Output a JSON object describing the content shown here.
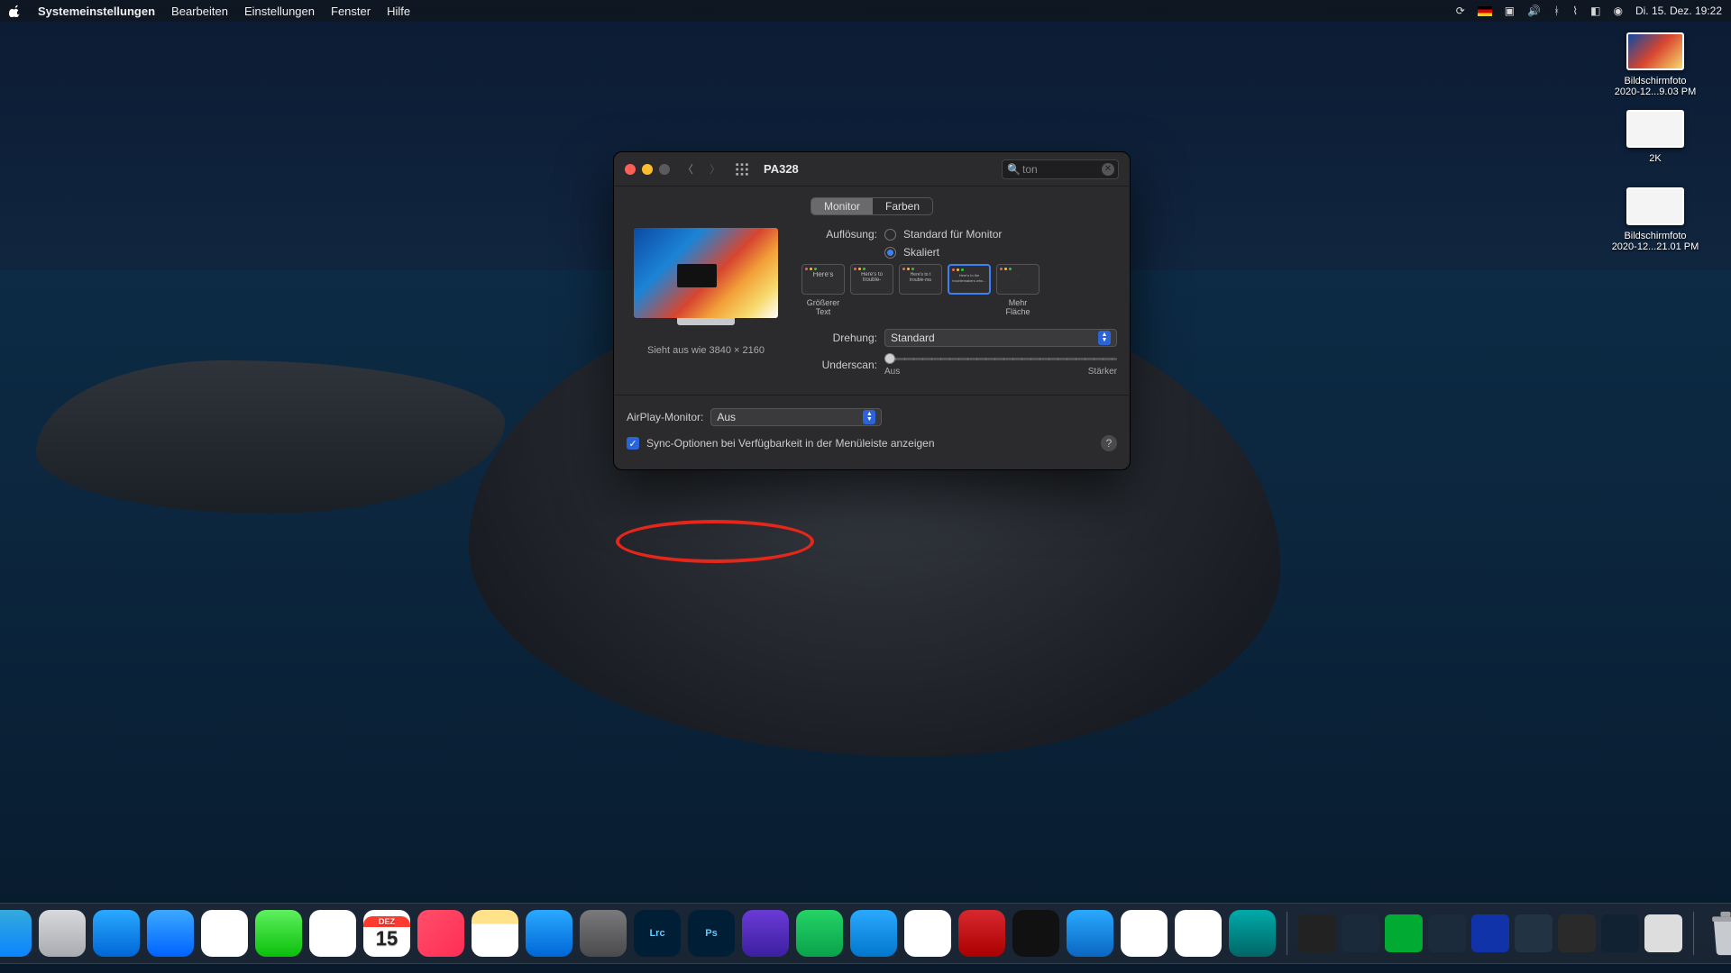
{
  "menubar": {
    "app": "Systemeinstellungen",
    "items": [
      "Bearbeiten",
      "Einstellungen",
      "Fenster",
      "Hilfe"
    ],
    "datetime": "Di. 15. Dez.  19:22"
  },
  "desktop": {
    "icons": [
      {
        "label_l1": "Bildschirmfoto",
        "label_l2": "2020-12...9.03 PM"
      },
      {
        "label_l1": "2K",
        "label_l2": ""
      },
      {
        "label_l1": "Bildschirmfoto",
        "label_l2": "2020-12...21.01 PM"
      }
    ]
  },
  "window": {
    "title": "PA328",
    "search_value": "ton",
    "tabs": {
      "monitor": "Monitor",
      "farben": "Farben"
    },
    "resolution_label": "Auflösung:",
    "res_std": "Standard für Monitor",
    "res_scaled": "Skaliert",
    "looks_like": "Sieht aus wie 3840 × 2160",
    "scale_opts": [
      {
        "preview": "Here's",
        "label": "Größerer Text"
      },
      {
        "preview": "Here's to trouble-",
        "label": ""
      },
      {
        "preview": "Here's to t trouble-ma",
        "label": ""
      },
      {
        "preview": "Here's to the troublemakers who...",
        "label": ""
      },
      {
        "preview": "",
        "label": "Mehr Fläche"
      }
    ],
    "rotation_label": "Drehung:",
    "rotation_value": "Standard",
    "underscan_label": "Underscan:",
    "underscan_min": "Aus",
    "underscan_max": "Stärker",
    "airplay_label": "AirPlay-Monitor:",
    "airplay_value": "Aus",
    "sync_label": "Sync-Optionen bei Verfügbarkeit in der Menüleiste anzeigen"
  },
  "dock": {
    "apps": [
      {
        "name": "Finder",
        "bg": "linear-gradient(180deg,#34aadc,#0a84ff)"
      },
      {
        "name": "Launchpad",
        "bg": "linear-gradient(180deg,#d7d9dc,#a9abb0)"
      },
      {
        "name": "Maps",
        "bg": "linear-gradient(180deg,#2aa9ff,#0066d6)"
      },
      {
        "name": "Safari",
        "bg": "linear-gradient(180deg,#3ca9ff,#0062ff)"
      },
      {
        "name": "Chrome",
        "bg": "#fff"
      },
      {
        "name": "Messages",
        "bg": "linear-gradient(180deg,#5ef05e,#0bbf0b)"
      },
      {
        "name": "Photos",
        "bg": "#fff"
      },
      {
        "name": "Calendar",
        "bg": "#fff",
        "text": "15",
        "top": "DEZ"
      },
      {
        "name": "Music",
        "bg": "linear-gradient(135deg,#ff4e6a,#ff2d55)"
      },
      {
        "name": "Notes",
        "bg": "linear-gradient(180deg,#ffe28a 0 30%,#fff 30%)"
      },
      {
        "name": "AppStore",
        "bg": "linear-gradient(180deg,#2aa9ff,#0066d6)"
      },
      {
        "name": "Settings",
        "bg": "linear-gradient(180deg,#7a7a7d,#4a4a4d)"
      },
      {
        "name": "Lrc",
        "bg": "#001e36",
        "text": "Lrc"
      },
      {
        "name": "Ps",
        "bg": "#001e36",
        "text": "Ps"
      },
      {
        "name": "iMovie",
        "bg": "linear-gradient(180deg,#6a3bd6,#3c1fa0)"
      },
      {
        "name": "WhatsApp",
        "bg": "linear-gradient(180deg,#25d366,#0aa24a)"
      },
      {
        "name": "Telegram",
        "bg": "linear-gradient(180deg,#2aa9ff,#0077cc)"
      },
      {
        "name": "Numbers",
        "bg": "#fff"
      },
      {
        "name": "CCleaner",
        "bg": "linear-gradient(180deg,#d7282f,#a00)"
      },
      {
        "name": "ActivityMonitor",
        "bg": "#111"
      },
      {
        "name": "AffinityPhoto",
        "bg": "linear-gradient(180deg,#2aa9ff,#0a66c2)"
      },
      {
        "name": "Pages",
        "bg": "#fff"
      },
      {
        "name": "LibreOffice",
        "bg": "#fff"
      },
      {
        "name": "App",
        "bg": "linear-gradient(180deg,#0aa,#066)"
      }
    ],
    "right_tiles": 9
  }
}
